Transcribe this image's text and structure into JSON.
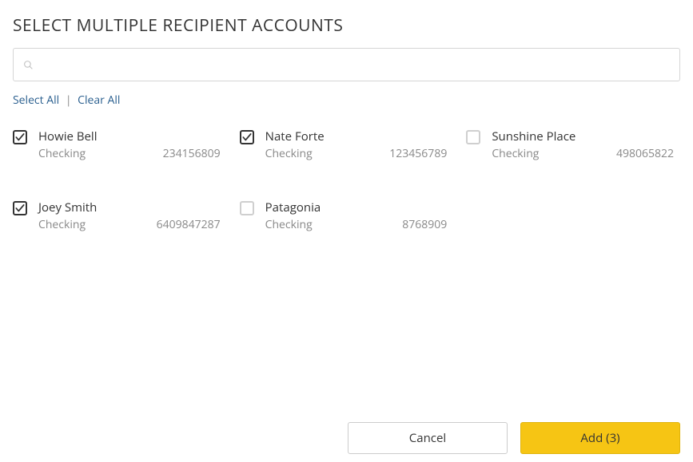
{
  "title": "SELECT MULTIPLE RECIPIENT ACCOUNTS",
  "search": {
    "placeholder": ""
  },
  "actions": {
    "select_all": "Select All",
    "clear_all": "Clear All",
    "divider": "|"
  },
  "accounts": [
    {
      "name": "Howie Bell",
      "type": "Checking",
      "number": "234156809",
      "checked": true
    },
    {
      "name": "Nate Forte",
      "type": "Checking",
      "number": "123456789",
      "checked": true
    },
    {
      "name": "Sunshine Place",
      "type": "Checking",
      "number": "498065822",
      "checked": false
    },
    {
      "name": "Joey Smith",
      "type": "Checking",
      "number": "6409847287",
      "checked": true
    },
    {
      "name": "Patagonia",
      "type": "Checking",
      "number": "8768909",
      "checked": false
    }
  ],
  "footer": {
    "cancel": "Cancel",
    "add": "Add (3)"
  }
}
